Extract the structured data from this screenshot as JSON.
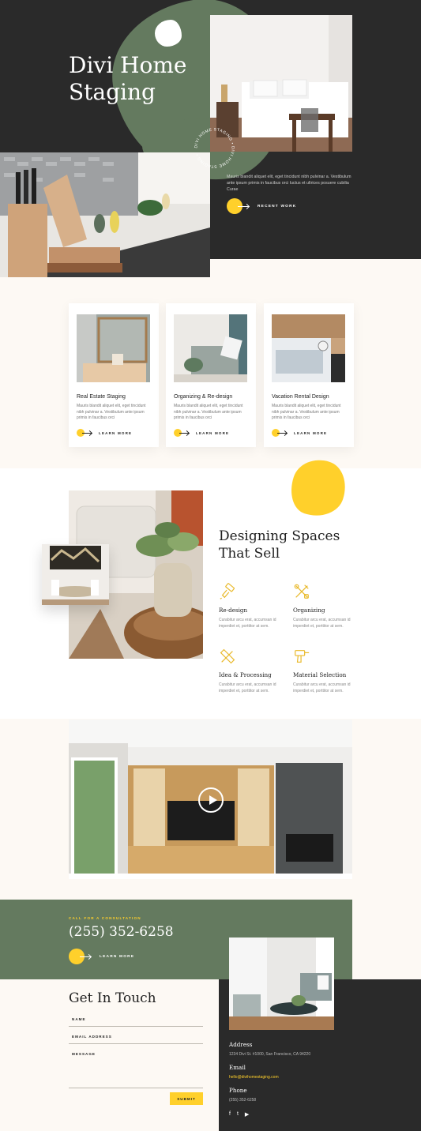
{
  "hero": {
    "title": "Divi Home Staging",
    "circle_text": "DIVI HOME STAGING • DIVI HOME STAGING •",
    "paragraph": "Mauris blandit aliquet elit, eget tincidunt nibh pulvinar a. Vestibulum ante ipsum primis in faucibus orci luctus et ultrices posuere cubilia Curae",
    "button_label": "RECENT WORK"
  },
  "services": [
    {
      "title": "Real Estate Staging",
      "text": "Mauris blandit aliquet elit, eget tincidunt nibh pulvinar a. Vestibulum ante ipsum primis in faucibus orci",
      "button": "LEARN MORE"
    },
    {
      "title": "Organizing & Re-design",
      "text": "Mauris blandit aliquet elit, eget tincidunt nibh pulvinar a. Vestibulum ante ipsum primis in faucibus orci",
      "button": "LEARN MORE"
    },
    {
      "title": "Vacation Rental Design",
      "text": "Mauris blandit aliquet elit, eget tincidunt nibh pulvinar a. Vestibulum ante ipsum primis in faucibus orci",
      "button": "LEARN MORE"
    }
  ],
  "design": {
    "title": "Designing Spaces That Sell",
    "features": [
      {
        "title": "Re-design",
        "text": "Curabitur arcu erat, accumsan id imperdiet et, porttitor at sem.",
        "icon": "paint-roller-icon"
      },
      {
        "title": "Organizing",
        "text": "Curabitur arcu erat, accumsan id imperdiet et, porttitor at sem.",
        "icon": "tools-icon"
      },
      {
        "title": "Idea & Processing",
        "text": "Curabitur arcu erat, accumsan id imperdiet et, porttitor at sem.",
        "icon": "pencil-ruler-icon"
      },
      {
        "title": "Material Selection",
        "text": "Curabitur arcu erat, accumsan id imperdiet et, porttitor at sem.",
        "icon": "drill-icon"
      }
    ]
  },
  "consultation": {
    "kicker": "CALL FOR A CONSULTATION",
    "phone": "(255) 352-6258",
    "button_label": "LEARN MORE"
  },
  "contact": {
    "title": "Get In Touch",
    "fields": {
      "name": "NAME",
      "email": "EMAIL ADDRESS",
      "message": "MESSAGE"
    },
    "submit": "SUBMIT",
    "address_label": "Address",
    "address": "1234 Divi St. #1000, San Francisco, CA 94220",
    "email_label": "Email",
    "email": "hello@divihomestaging.com",
    "phone_label": "Phone",
    "phone": "(255) 352-6258",
    "social": [
      "f",
      "t",
      "▶"
    ]
  },
  "colors": {
    "dark": "#2a2a2a",
    "green": "#647a5f",
    "yellow": "#ffd02b",
    "cream": "#fdf9f4"
  }
}
